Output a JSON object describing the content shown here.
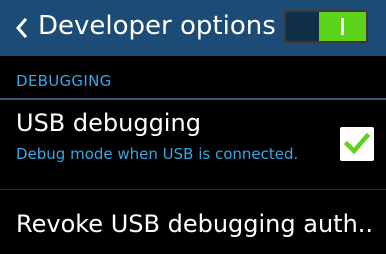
{
  "action_bar": {
    "title": "Developer options",
    "back_icon": "chevron-left-icon",
    "master_switch": {
      "state": "on",
      "color": "#5ed31c"
    },
    "background": "#1c4c76"
  },
  "section": {
    "label": "DEBUGGING",
    "color": "#33a8e5"
  },
  "usb_debugging": {
    "title": "USB debugging",
    "summary": "Debug mode when USB is connected.",
    "checked": true,
    "check_color": "#5ed31c"
  },
  "revoke": {
    "title": "Revoke USB debugging auth.."
  }
}
